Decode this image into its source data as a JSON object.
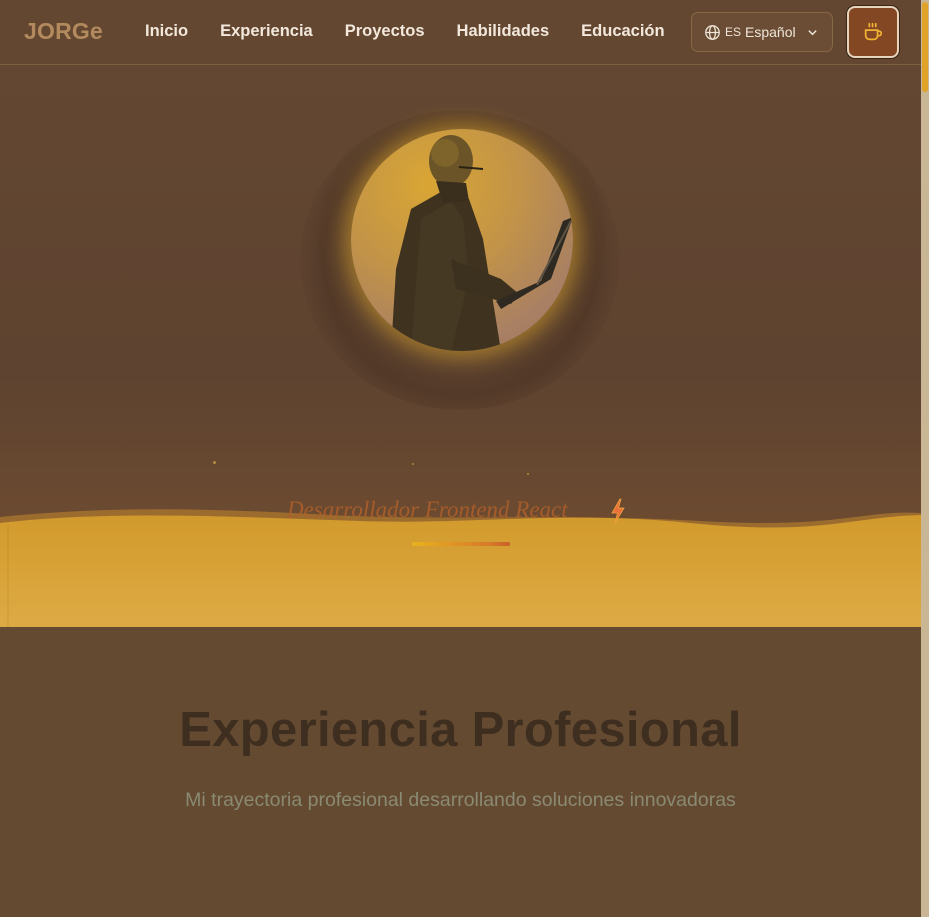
{
  "header": {
    "logo": "JORGe",
    "nav": [
      "Inicio",
      "Experiencia",
      "Proyectos",
      "Habilidades",
      "Educación"
    ],
    "language": {
      "code": "ES",
      "name": "Español"
    },
    "theme_icon": "coffee-cup-icon"
  },
  "hero": {
    "subtitle": "Desarrollador Frontend React",
    "subtitle_icon": "lightning-bolt-icon",
    "accent": "#e2ab28"
  },
  "experience": {
    "title": "Experiencia Profesional",
    "subtitle": "Mi trayectoria profesional desarrollando soluciones innovadoras"
  },
  "colors": {
    "background": "#654a32",
    "sand": "#d9a02c",
    "theme_button": "#844724"
  }
}
